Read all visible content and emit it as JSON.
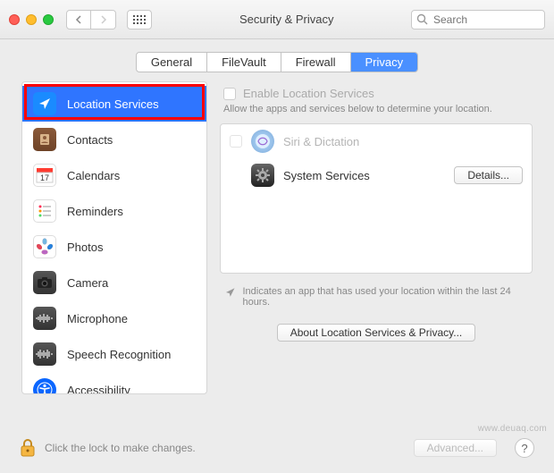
{
  "window": {
    "title": "Security & Privacy",
    "search_placeholder": "Search"
  },
  "tabs": [
    {
      "label": "General"
    },
    {
      "label": "FileVault"
    },
    {
      "label": "Firewall"
    },
    {
      "label": "Privacy",
      "active": true
    }
  ],
  "sidebar": {
    "items": [
      {
        "label": "Location Services",
        "selected": true
      },
      {
        "label": "Contacts"
      },
      {
        "label": "Calendars"
      },
      {
        "label": "Reminders"
      },
      {
        "label": "Photos"
      },
      {
        "label": "Camera"
      },
      {
        "label": "Microphone"
      },
      {
        "label": "Speech Recognition"
      },
      {
        "label": "Accessibility"
      }
    ]
  },
  "content": {
    "enable_label": "Enable Location Services",
    "enable_checked": false,
    "description": "Allow the apps and services below to determine your location.",
    "apps": [
      {
        "label": "Siri & Dictation",
        "disabled": true,
        "has_checkbox": true
      },
      {
        "label": "System Services",
        "button": "Details..."
      }
    ],
    "note": "Indicates an app that has used your location within the last 24 hours.",
    "about_button": "About Location Services & Privacy..."
  },
  "footer": {
    "lock_text": "Click the lock to make changes.",
    "advanced_button": "Advanced...",
    "help": "?"
  },
  "watermark": "www.deuaq.com"
}
